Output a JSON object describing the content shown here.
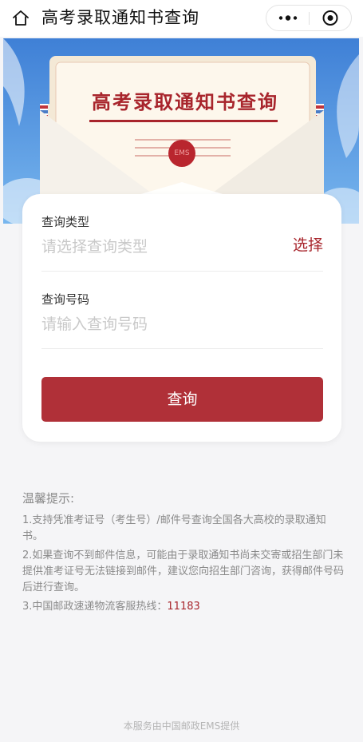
{
  "navbar": {
    "title": "高考录取通知书查询",
    "home_icon": "home-icon",
    "more_icon": "more-dots-icon",
    "close_icon": "miniprogram-close-icon"
  },
  "banner": {
    "letter_title": "高考录取通知书查询",
    "seal_text": "EMS"
  },
  "form": {
    "type_label": "查询类型",
    "type_placeholder": "请选择查询类型",
    "select_label": "选择",
    "number_label": "查询号码",
    "number_placeholder": "请输入查询号码",
    "submit_label": "查询"
  },
  "tips": {
    "title": "温馨提示:",
    "items": [
      "1.支持凭准考证号（考生号）/邮件号查询全国各大高校的录取通知书。",
      "2.如果查询不到邮件信息，可能由于录取通知书尚未交寄或招生部门未提供准考证号无法链接到邮件，建议您向招生部门咨询，获得邮件号码后进行查询。",
      "3.中国邮政速递物流客服热线："
    ],
    "hotline": "11183"
  },
  "footer": "本服务由中国邮政EMS提供",
  "colors": {
    "accent": "#a8252c",
    "button": "#b03038",
    "sky": "#4f8fe0",
    "envelope": "#f6f1e8",
    "letter": "#fdf6ea"
  }
}
